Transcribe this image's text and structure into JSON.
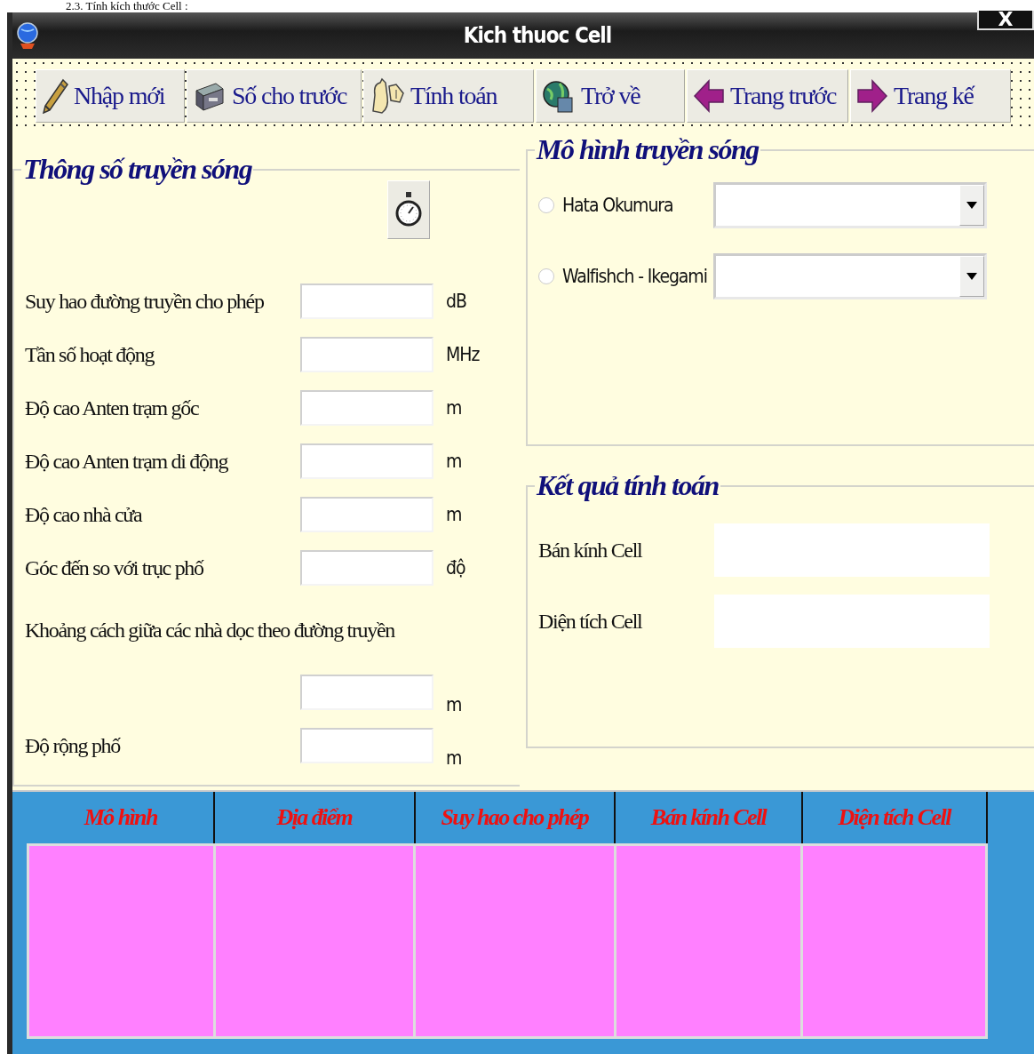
{
  "document_heading": "2.3. Tính kích thước Cell :",
  "window": {
    "title": "Kich thuoc Cell",
    "close": "X"
  },
  "toolbar": [
    {
      "label": "Nhập mới"
    },
    {
      "label": "Số cho trước"
    },
    {
      "label": "Tính toán"
    },
    {
      "label": "Trở về"
    },
    {
      "label": "Trang trước"
    },
    {
      "label": "Trang kế"
    }
  ],
  "params": {
    "title": "Thông số truyền sóng",
    "rows": [
      {
        "kind": "inline",
        "label": "Suy hao đường truyền cho phép",
        "unit": "dB"
      },
      {
        "kind": "inline",
        "label": "Tần số hoạt động",
        "unit": "MHz"
      },
      {
        "kind": "inline",
        "label": "Độ cao Anten trạm gốc",
        "unit": "m"
      },
      {
        "kind": "inline",
        "label": "Độ cao Anten trạm di động",
        "unit": "m"
      },
      {
        "kind": "inline",
        "label": "Độ cao nhà cửa",
        "unit": "m"
      },
      {
        "kind": "inline",
        "label": "Góc đến so với trục phố",
        "unit": "độ"
      },
      {
        "kind": "stacked",
        "label": "Khoảng cách giữa các nhà dọc theo đường truyền",
        "unit": "m"
      },
      {
        "kind": "inline",
        "label": "Độ rộng phố",
        "unit": "m"
      }
    ]
  },
  "models": {
    "title": "Mô hình truyền sóng",
    "options": [
      {
        "label": "Hata Okumura",
        "selected": false
      },
      {
        "label": "Walfishch - Ikegami",
        "selected": false
      }
    ]
  },
  "results": {
    "title": "Kết quả tính toán",
    "rows": [
      {
        "label": "Bán kính Cell"
      },
      {
        "label": "Diện tích Cell"
      }
    ]
  },
  "table": {
    "columns": [
      "Mô hình",
      "Địa điểm",
      "Suy hao cho phép",
      "Bán kính Cell",
      "Diện tích Cell"
    ]
  }
}
